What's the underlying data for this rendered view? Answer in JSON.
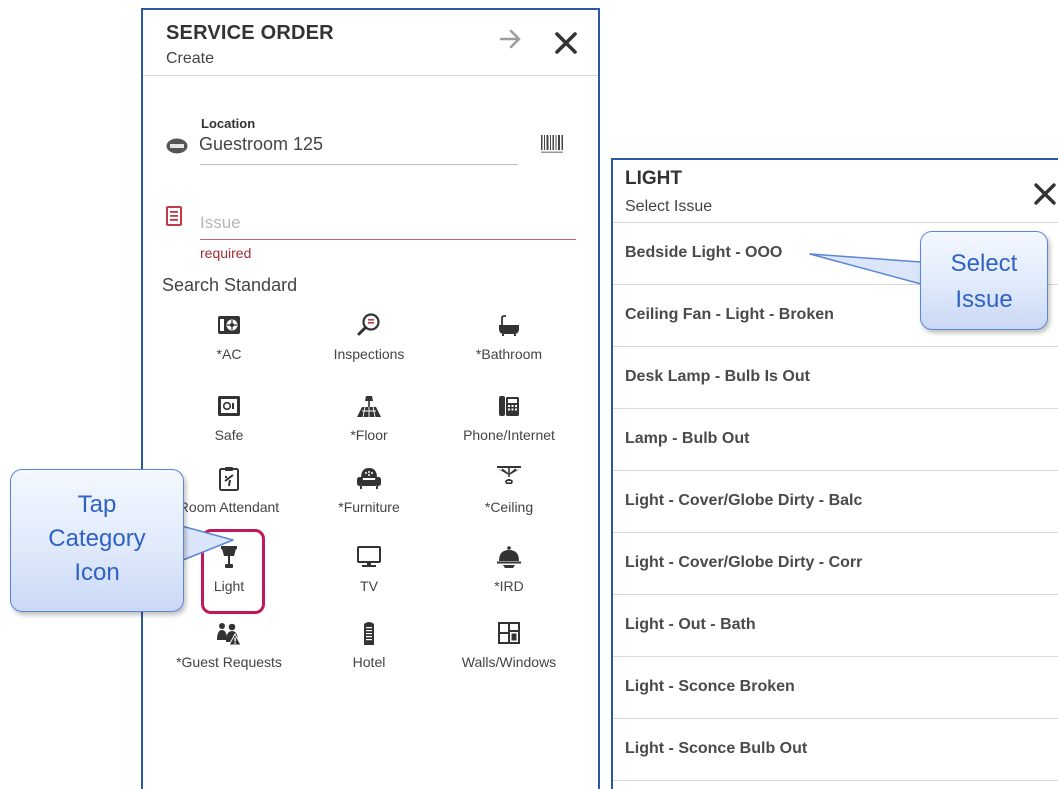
{
  "service_order": {
    "title": "SERVICE ORDER",
    "subtitle": "Create",
    "location_label": "Location",
    "location_value": "Guestroom  125",
    "issue_placeholder": "Issue",
    "required_text": "required",
    "search_standard_label": "Search Standard",
    "categories": [
      {
        "label": "*AC",
        "icon": "ac-unit-icon"
      },
      {
        "label": "Inspections",
        "icon": "magnifier-icon"
      },
      {
        "label": "*Bathroom",
        "icon": "bathtub-icon"
      },
      {
        "label": "Safe",
        "icon": "safe-icon"
      },
      {
        "label": "*Floor",
        "icon": "floor-lamp-icon"
      },
      {
        "label": "Phone/Internet",
        "icon": "phone-icon"
      },
      {
        "label": "Room Attendant",
        "icon": "clipboard-icon"
      },
      {
        "label": "*Furniture",
        "icon": "armchair-icon"
      },
      {
        "label": "*Ceiling",
        "icon": "ceiling-fan-icon"
      },
      {
        "label": "Light",
        "icon": "light-icon"
      },
      {
        "label": "TV",
        "icon": "tv-icon"
      },
      {
        "label": "*IRD",
        "icon": "cloche-icon"
      },
      {
        "label": "*Guest Requests",
        "icon": "guests-icon"
      },
      {
        "label": "Hotel",
        "icon": "hotel-building-icon"
      },
      {
        "label": "Walls/Windows",
        "icon": "window-icon"
      }
    ]
  },
  "light_panel": {
    "title": "LIGHT",
    "subtitle": "Select Issue",
    "issues": [
      "Bedside Light - OOO",
      "Ceiling Fan - Light - Broken",
      "Desk Lamp - Bulb Is Out",
      "Lamp - Bulb Out",
      "Light - Cover/Globe Dirty - Balc",
      "Light - Cover/Globe Dirty - Corr",
      "Light - Out - Bath",
      "Light - Sconce Broken",
      "Light - Sconce Bulb Out"
    ]
  },
  "callouts": {
    "tap": [
      "Tap",
      "Category",
      "Icon"
    ],
    "select": [
      "Select",
      "Issue"
    ]
  },
  "colors": {
    "panel_border": "#2b5aa5",
    "highlight": "#c2185b",
    "required": "#a02c35",
    "callout_text": "#2f62c4"
  }
}
